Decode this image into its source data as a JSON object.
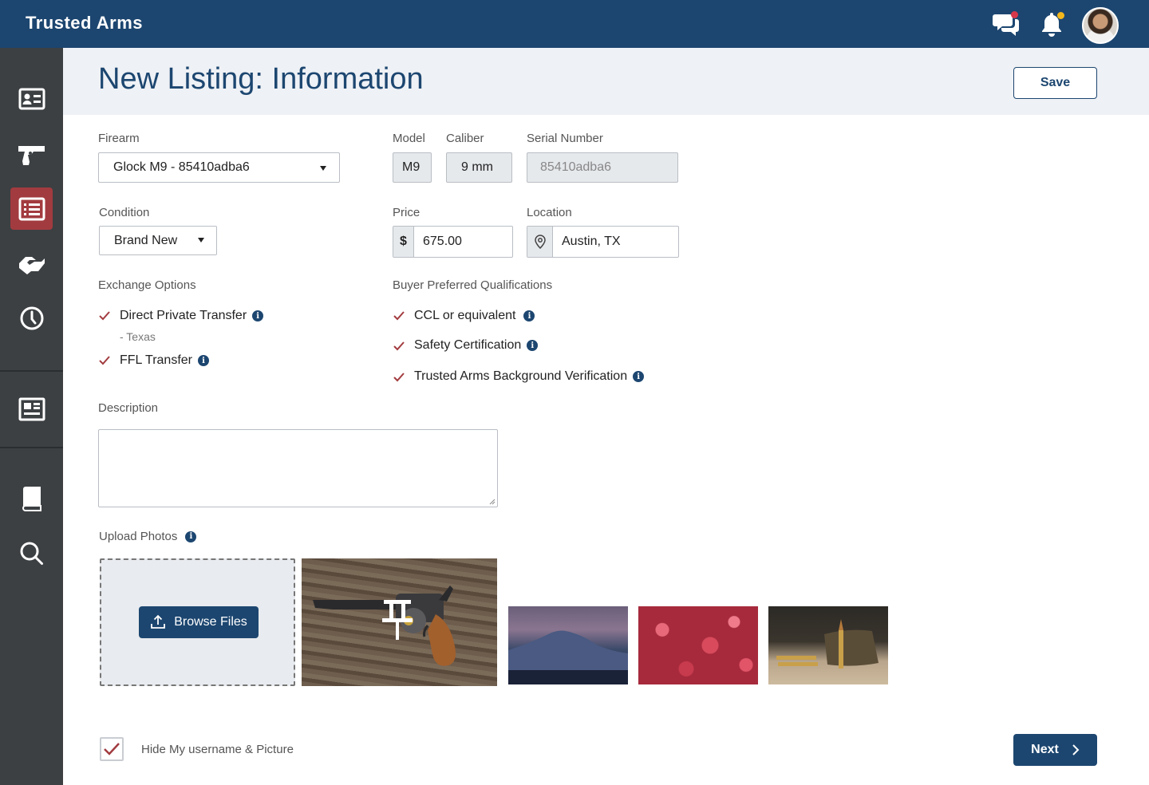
{
  "app": {
    "brand": "Trusted Arms"
  },
  "header": {
    "title": "New Listing: Information",
    "save_label": "Save"
  },
  "sidebar": {
    "items": [
      {
        "icon": "id-card-icon"
      },
      {
        "icon": "pistol-icon"
      },
      {
        "icon": "listing-icon",
        "active": true
      },
      {
        "icon": "handshake-icon"
      },
      {
        "icon": "clock-icon"
      },
      {
        "icon": "newspaper-icon"
      },
      {
        "icon": "book-icon"
      },
      {
        "icon": "search-icon"
      }
    ]
  },
  "form": {
    "firearm": {
      "label": "Firearm",
      "value": "Glock M9 - 85410adba6"
    },
    "model": {
      "label": "Model",
      "value": "M9"
    },
    "caliber": {
      "label": "Caliber",
      "value": "9 mm"
    },
    "serial": {
      "label": "Serial Number",
      "value": "85410adba6"
    },
    "condition": {
      "label": "Condition",
      "value": "Brand New"
    },
    "price": {
      "label": "Price",
      "currency": "$",
      "value": "675.00"
    },
    "location": {
      "label": "Location",
      "value": "Austin, TX"
    },
    "exchange": {
      "label": "Exchange Options",
      "options": [
        {
          "label": "Direct Private Transfer",
          "sub": "- Texas",
          "checked": true
        },
        {
          "label": "FFL Transfer",
          "checked": true
        }
      ]
    },
    "qualifications": {
      "label": "Buyer Preferred Qualifications",
      "options": [
        {
          "label": "CCL or equivalent",
          "checked": true
        },
        {
          "label": "Safety Certification",
          "checked": true
        },
        {
          "label": "Trusted Arms Background Verification",
          "checked": true
        }
      ]
    },
    "description": {
      "label": "Description",
      "value": ""
    },
    "photos": {
      "label": "Upload Photos",
      "browse_label": "Browse Files",
      "items": [
        "revolver-photo",
        "mountain-photo",
        "flowers-photo",
        "ammo-photo"
      ]
    },
    "hide_identity": {
      "label": "Hide My username & Picture",
      "checked": true
    },
    "next_label": "Next"
  },
  "colors": {
    "primary": "#1c4670",
    "accent": "#a23b3f",
    "sidebar": "#3c4043"
  }
}
